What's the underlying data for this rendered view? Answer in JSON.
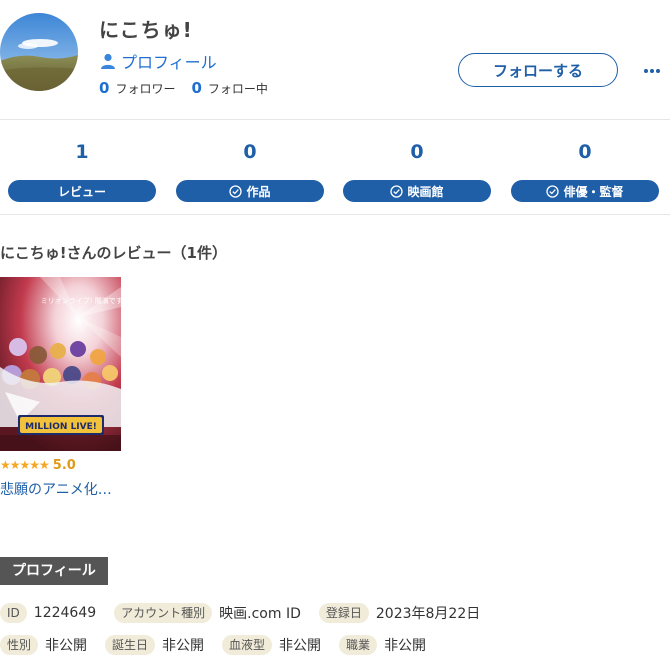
{
  "user": {
    "name": "にこちゅ!",
    "profile_link": "プロフィール",
    "followers_count": "0",
    "followers_label": "フォロワー",
    "following_count": "0",
    "following_label": "フォロー中",
    "follow_button": "フォローする",
    "more_icon": "more-horizontal-icon"
  },
  "stats": [
    {
      "count": "1",
      "label": "レビュー",
      "check": false
    },
    {
      "count": "0",
      "label": "作品",
      "check": true
    },
    {
      "count": "0",
      "label": "映画館",
      "check": true
    },
    {
      "count": "0",
      "label": "俳優・監督",
      "check": true
    }
  ],
  "reviews": {
    "title": "にこちゅ!さんのレビュー（1件）",
    "items": [
      {
        "poster_text": "ミリオンライブ! 開演です!!!",
        "poster_logo": "MILLION LIVE!",
        "stars": "★★★★★",
        "score": "5.0",
        "title": "悲願のアニメ化…"
      }
    ]
  },
  "profile": {
    "heading": "プロフィール",
    "row1": [
      {
        "tag": "ID",
        "value": "1224649"
      },
      {
        "tag": "アカウント種別",
        "value": "映画.com ID"
      },
      {
        "tag": "登録日",
        "value": "2023年8月22日"
      }
    ],
    "row2": [
      {
        "tag": "性別",
        "value": "非公開"
      },
      {
        "tag": "誕生日",
        "value": "非公開"
      },
      {
        "tag": "血液型",
        "value": "非公開"
      },
      {
        "tag": "職業",
        "value": "非公開"
      }
    ]
  },
  "colors": {
    "accent": "#1f5fa8",
    "link": "#1f6fd1",
    "star": "#f5a623",
    "tag_bg": "#f1ecd9"
  }
}
